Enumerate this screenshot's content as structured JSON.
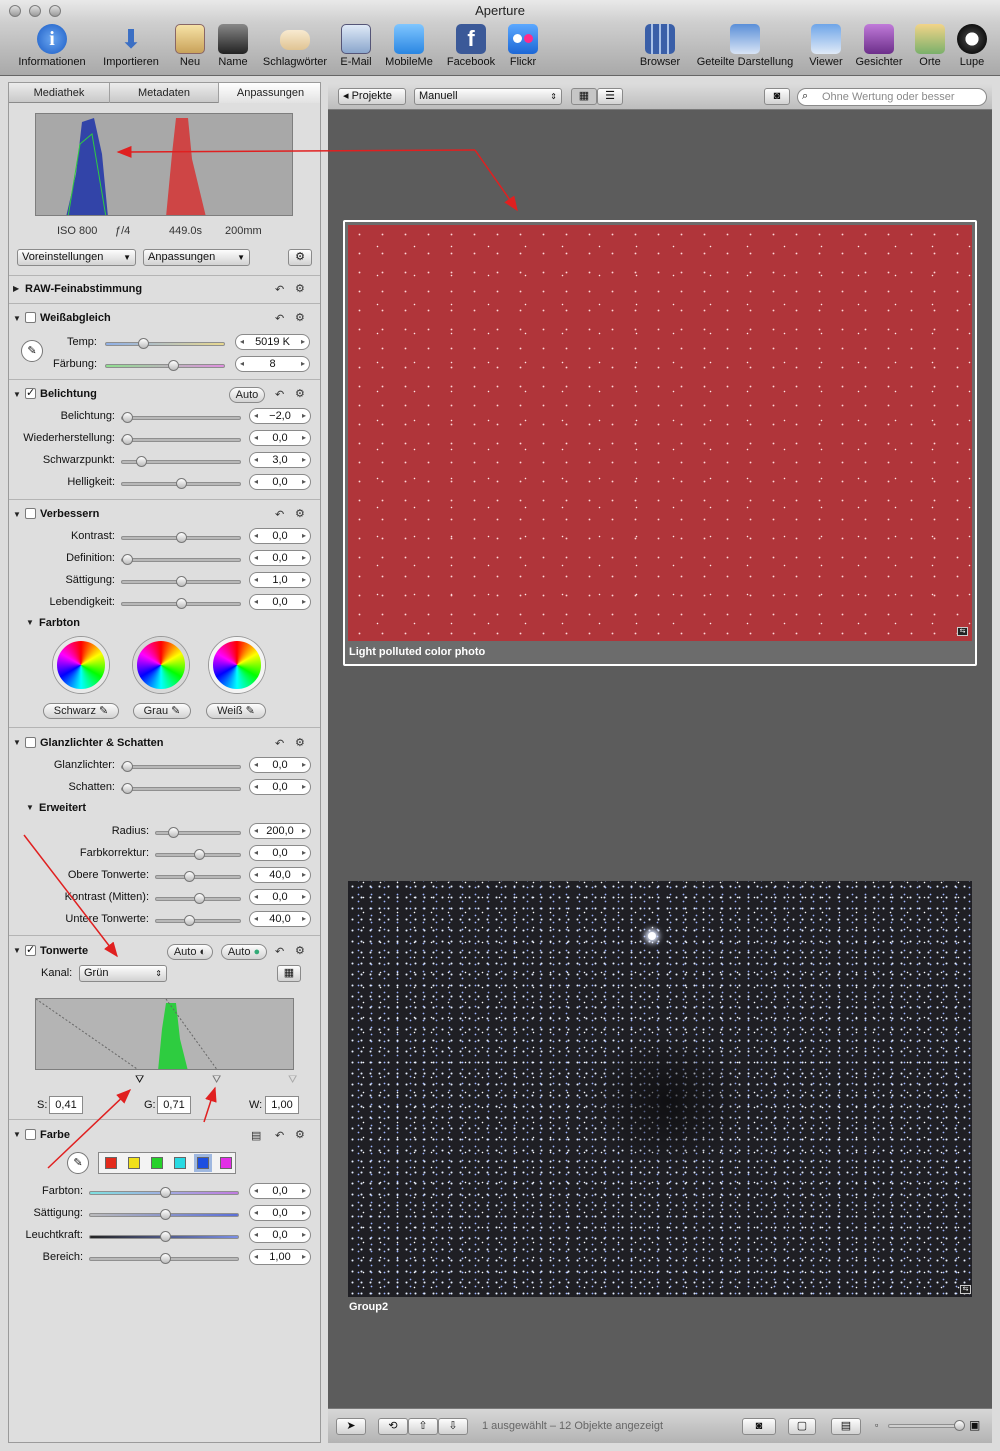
{
  "window": {
    "title": "Aperture"
  },
  "toolbar": {
    "items_left": [
      "Informationen",
      "Importieren",
      "Neu",
      "Name",
      "Schlagwörter",
      "E-Mail",
      "MobileMe",
      "Facebook",
      "Flickr"
    ],
    "items_right": [
      "Browser",
      "Geteilte Darstellung",
      "Viewer",
      "Gesichter",
      "Orte",
      "Lupe"
    ]
  },
  "tabs": [
    "Mediathek",
    "Metadaten",
    "Anpassungen"
  ],
  "histogram": {
    "iso": "ISO 800",
    "aperture": "ƒ/4",
    "shutter": "449.0s",
    "focal": "200mm"
  },
  "presets": {
    "voreinstellungen": "Voreinstellungen",
    "anpassungen": "Anpassungen"
  },
  "sections": {
    "raw": {
      "title": "RAW-Feinabstimmung"
    },
    "wb": {
      "title": "Weißabgleich",
      "temp_label": "Temp:",
      "temp_val": "5019 K",
      "tint_label": "Färbung:",
      "tint_val": "8"
    },
    "exposure": {
      "title": "Belichtung",
      "auto": "Auto",
      "rows": [
        {
          "label": "Belichtung:",
          "value": "−2,0"
        },
        {
          "label": "Wiederherstellung:",
          "value": "0,0"
        },
        {
          "label": "Schwarzpunkt:",
          "value": "3,0"
        },
        {
          "label": "Helligkeit:",
          "value": "0,0"
        }
      ]
    },
    "enhance": {
      "title": "Verbessern",
      "rows": [
        {
          "label": "Kontrast:",
          "value": "0,0"
        },
        {
          "label": "Definition:",
          "value": "0,0"
        },
        {
          "label": "Sättigung:",
          "value": "1,0"
        },
        {
          "label": "Lebendigkeit:",
          "value": "0,0"
        }
      ],
      "farbton": "Farbton",
      "black": "Schwarz",
      "gray": "Grau",
      "white": "Weiß"
    },
    "hs": {
      "title": "Glanzlichter & Schatten",
      "rows": [
        {
          "label": "Glanzlichter:",
          "value": "0,0"
        },
        {
          "label": "Schatten:",
          "value": "0,0"
        }
      ],
      "advanced": "Erweitert",
      "adv_rows": [
        {
          "label": "Radius:",
          "value": "200,0"
        },
        {
          "label": "Farbkorrektur:",
          "value": "0,0"
        },
        {
          "label": "Obere Tonwerte:",
          "value": "40,0"
        },
        {
          "label": "Kontrast (Mitten):",
          "value": "0,0"
        },
        {
          "label": "Untere Tonwerte:",
          "value": "40,0"
        }
      ]
    },
    "levels": {
      "title": "Tonwerte",
      "auto1": "Auto",
      "auto2": "Auto",
      "channel_label": "Kanal:",
      "channel": "Grün",
      "s_label": "S:",
      "s_val": "0,41",
      "g_label": "G:",
      "g_val": "0,71",
      "w_label": "W:",
      "w_val": "1,00"
    },
    "color": {
      "title": "Farbe",
      "swatches": [
        "#e32b1c",
        "#f0e01a",
        "#26d12a",
        "#28d9e2",
        "#1d4fe0",
        "#e22ee6"
      ],
      "rows": [
        {
          "label": "Farbton:",
          "value": "0,0"
        },
        {
          "label": "Sättigung:",
          "value": "0,0"
        },
        {
          "label": "Leuchtkraft:",
          "value": "0,0"
        },
        {
          "label": "Bereich:",
          "value": "1,00"
        }
      ]
    }
  },
  "viewer": {
    "projects_btn": "Projekte",
    "sort": "Manuell",
    "search_placeholder": "Ohne Wertung oder besser",
    "photo1_caption": "Light polluted color photo",
    "photo2_caption": "Group2",
    "status": "1 ausgewählt – 12 Objekte angezeigt"
  }
}
